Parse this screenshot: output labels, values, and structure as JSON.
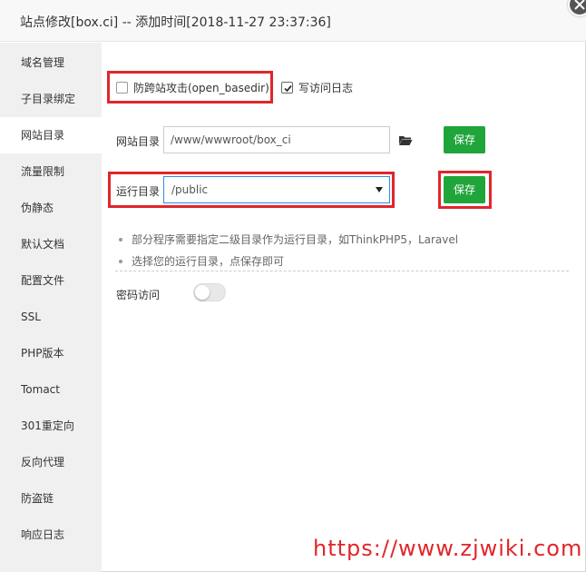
{
  "dialog": {
    "title": "站点修改[box.ci] -- 添加时间[2018-11-27 23:37:36]"
  },
  "sidebar": {
    "items": [
      {
        "label": "域名管理"
      },
      {
        "label": "子目录绑定"
      },
      {
        "label": "网站目录",
        "active": true
      },
      {
        "label": "流量限制"
      },
      {
        "label": "伪静态"
      },
      {
        "label": "默认文档"
      },
      {
        "label": "配置文件"
      },
      {
        "label": "SSL"
      },
      {
        "label": "PHP版本"
      },
      {
        "label": "Tomact"
      },
      {
        "label": "301重定向"
      },
      {
        "label": "反向代理"
      },
      {
        "label": "防盗链"
      },
      {
        "label": "响应日志"
      }
    ]
  },
  "options": {
    "open_basedir_label": "防跨站攻击(open_basedir)",
    "open_basedir_checked": false,
    "access_log_label": "写访问日志",
    "access_log_checked": true
  },
  "site_dir": {
    "label": "网站目录",
    "value": "/www/wwwroot/box_ci",
    "save_label": "保存"
  },
  "run_dir": {
    "label": "运行目录",
    "selected": "/public",
    "save_label": "保存"
  },
  "tips": [
    "部分程序需要指定二级目录作为运行目录，如ThinkPHP5，Laravel",
    "选择您的运行目录，点保存即可"
  ],
  "password_access": {
    "label": "密码访问",
    "enabled": false
  },
  "watermark": "https://www.zjwiki.com",
  "colors": {
    "accent_green": "#20a53a",
    "highlight_red": "#e0262b",
    "select_border": "#2f8be0"
  }
}
